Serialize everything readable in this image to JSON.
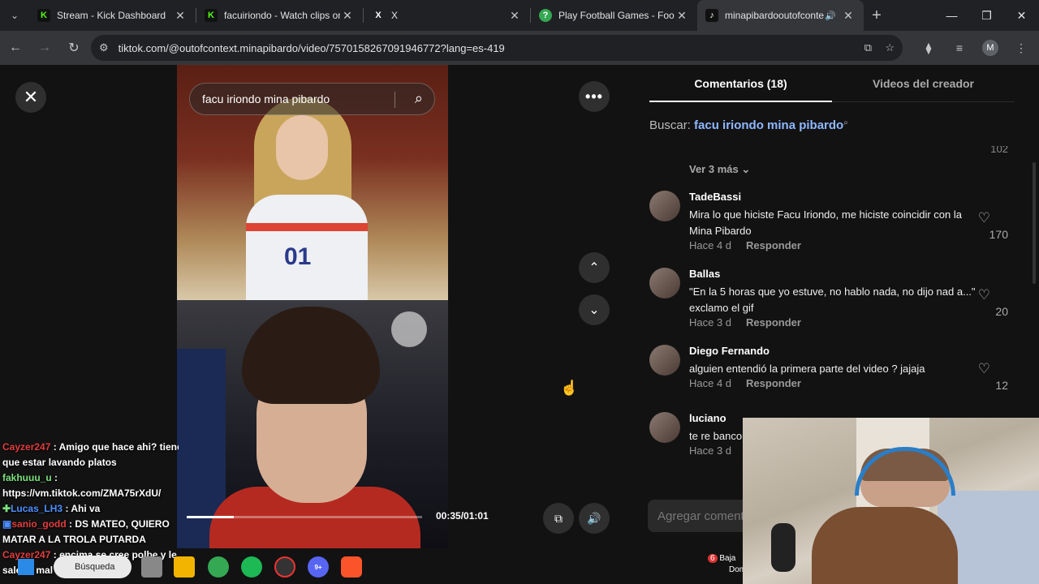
{
  "browser": {
    "tabs": [
      {
        "title": "Stream - Kick Dashboard",
        "favicon": "K",
        "color": "#53fc18"
      },
      {
        "title": "facuiriondo - Watch clips on",
        "favicon": "K",
        "color": "#53fc18"
      },
      {
        "title": "X",
        "favicon": "X",
        "color": "#ffffff"
      },
      {
        "title": "Play Football Games - Footb",
        "favicon": "?",
        "color": "#34a853"
      },
      {
        "title": "minapibardooutofconte",
        "favicon": "♪",
        "color": "#ffffff",
        "active": true
      }
    ],
    "url": "tiktok.com/@outofcontext.minapibardo/video/7570158267091946772?lang=es-419",
    "profile_initial": "M"
  },
  "video": {
    "search_query": "facu iriondo mina pibardo",
    "time": "00:35/01:01",
    "progress": 0.2,
    "jersey_number": "01"
  },
  "panel": {
    "tab_comments": "Comentarios (18)",
    "tab_creator": "Videos del creador",
    "search_label": "Buscar:",
    "search_query": "facu iriondo mina pibardo",
    "fragment_count": "102",
    "ver_mas": "Ver 3 más",
    "reply_label": "Responder",
    "add_comment_placeholder": "Agregar comentario...",
    "comments": [
      {
        "user": "TadeBassi",
        "text": "Mira lo que hiciste Facu Iriondo, me hiciste coincidir con la Mina Pibardo",
        "time": "Hace 4 d",
        "likes": "170"
      },
      {
        "user": "Ballas",
        "text": "\"En la 5 horas que yo estuve, no hablo nada, no dijo nad a...\" exclamo el gif",
        "time": "Hace 3 d",
        "likes": "20"
      },
      {
        "user": "Diego Fernando",
        "text": "alguien entendió la primera parte del video ? jajaja",
        "time": "Hace 4 d",
        "likes": "12"
      },
      {
        "user": "luciano",
        "text": "te re banco",
        "time": "Hace 3 d",
        "likes": ""
      }
    ]
  },
  "chat": [
    {
      "name": "Cayzer247",
      "msg": ": Amigo que hace ahi? tiene"
    },
    {
      "name": "",
      "msg": "que estar lavando platos"
    },
    {
      "name": "fakhuuu_u",
      "msg": ":"
    },
    {
      "name": "",
      "msg": "https://vm.tiktok.com/ZMA75rXdU/"
    },
    {
      "name": "Lucas_LH3",
      "msg": ": Ahi va"
    },
    {
      "name": "sanio_godd",
      "msg": ": DS MATEO, QUIERO"
    },
    {
      "name": "",
      "msg": "MATAR A LA TROLA PUTARDA"
    },
    {
      "name": "Cayzer247",
      "msg": ": encima se cree polbe y le"
    },
    {
      "name": "",
      "msg": "sale re mal"
    }
  ],
  "taskbar": {
    "search": "Búsqueda",
    "discord_badge": "9+",
    "tray_badge": "6",
    "tray_text_1": "Baja",
    "tray_text_2": "Dom"
  }
}
